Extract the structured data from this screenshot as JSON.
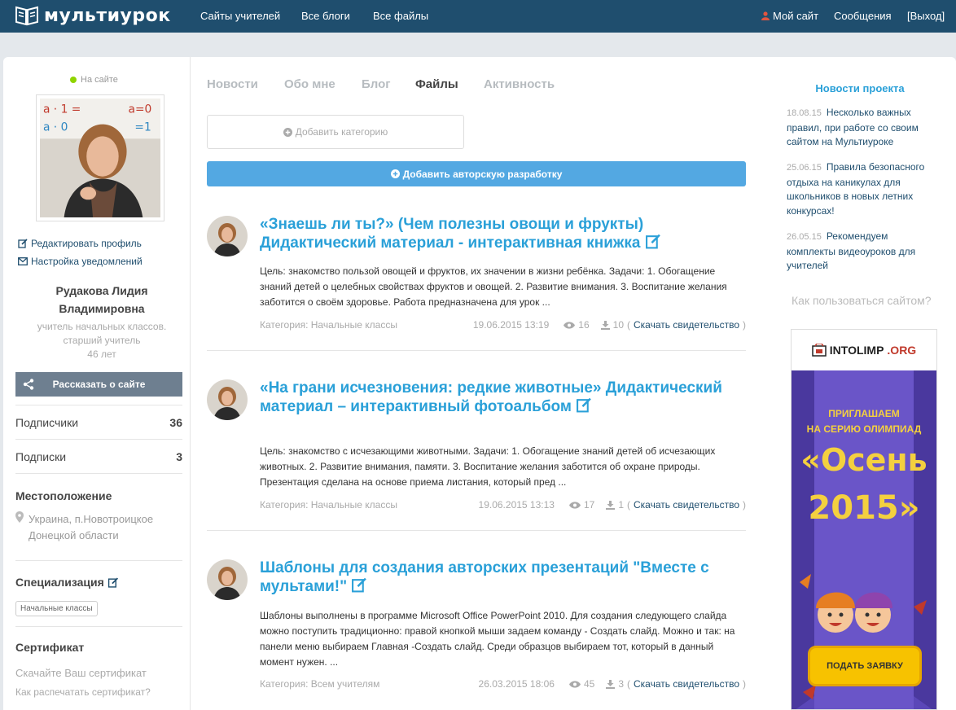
{
  "header": {
    "logo_text": "мультиурок",
    "nav": [
      "Сайты учителей",
      "Все блоги",
      "Все файлы"
    ],
    "my_site": "Мой сайт",
    "messages": "Сообщения",
    "logout": "[Выход]"
  },
  "sidebar": {
    "online": "На сайте",
    "edit_profile": "Редактировать профиль",
    "notifications": "Настройка уведомлений",
    "name_line1": "Рудакова Лидия",
    "name_line2": "Владимировна",
    "role_line1": "учитель начальных классов.",
    "role_line2": "старший учитель",
    "age": "46 лет",
    "share": "Рассказать о сайте",
    "subscribers_label": "Подписчики",
    "subscribers_count": "36",
    "subscriptions_label": "Подписки",
    "subscriptions_count": "3",
    "location_title": "Местоположение",
    "location_line1": "Украина, п.Новотроицкое",
    "location_line2": "Донецкой области",
    "specialization_title": "Специализация",
    "specialization_tag": "Начальные классы",
    "certificate_title": "Сертификат",
    "certificate_download": "Скачайте Ваш сертификат",
    "certificate_print": "Как распечатать сертификат?"
  },
  "tabs": [
    {
      "label": "Новости"
    },
    {
      "label": "Обо мне"
    },
    {
      "label": "Блог"
    },
    {
      "label": "Файлы",
      "active": true
    },
    {
      "label": "Активность"
    }
  ],
  "actions": {
    "add_category": "Добавить категорию",
    "add_development": "Добавить авторскую разработку"
  },
  "posts": [
    {
      "title": "«Знаешь ли ты?» (Чем полезны овощи и фрукты) Дидактический материал - интерактивная книжка",
      "desc": "Цель: знакомство пользой овощей и фруктов, их значении в жизни ребёнка. Задачи: 1. Обогащение знаний детей о целебных свойствах фруктов и овощей. 2. Развитие внимания. 3. Воспитание желания заботится о своём здоровье. Работа предназначена для урок ...",
      "category": "Категория: Начальные классы",
      "date": "19.06.2015 13:19",
      "views": "16",
      "downloads": "10",
      "download_link": "Скачать свидетельство"
    },
    {
      "title": "«На грани исчезновения: редкие животные» Дидактический материал – интерактивный фотоальбом",
      "desc": "Цель: знакомство с исчезающими животными. Задачи:  1. Обогащение знаний детей об исчезающих животных. 2. Развитие внимания, памяти. 3. Воспитание желания заботится об охране природы. Презентация сделана на основе приема листания, который пред ...",
      "category": "Категория: Начальные классы",
      "date": "19.06.2015 13:13",
      "views": "17",
      "downloads": "1",
      "download_link": "Скачать свидетельство"
    },
    {
      "title": "Шаблоны для создания авторских презентаций \"Вместе с мультами!\"",
      "desc": "Шаблоны выполнены в программе Microsoft Office PowerPoint 2010. Для создания следующего слайда можно поступить традиционно: правой кнопкой мыши задаем команду - Создать слайд. Можно и так: на панели меню выбираем Главная -Создать слайд. Среди образцов выбираем тот, который в данный момент нужен. ...",
      "category": "Категория: Всем учителям",
      "date": "26.03.2015 18:06",
      "views": "45",
      "downloads": "3",
      "download_link": "Скачать свидетельство"
    }
  ],
  "news": {
    "title": "Новости проекта",
    "items": [
      {
        "date": "18.08.15",
        "text": "Несколько важных правил, при работе со своим сайтом на Мультиуроке"
      },
      {
        "date": "25.06.15",
        "text": "Правила безопасного отдыха на каникулах для школьников в новых летних конкурсах!"
      },
      {
        "date": "26.05.15",
        "text": "Рекомендуем комплекты видеоуроков для учителей"
      }
    ],
    "howto": "Как пользоваться сайтом?"
  },
  "banner": {
    "brand_main": "INTOLIMP",
    "brand_suffix": ".ORG",
    "line1": "ПРИГЛАШАЕМ",
    "line2": "НА СЕРИЮ ОЛИМПИАД",
    "big1": "«Осень",
    "big2": "2015»",
    "button": "ПОДАТЬ ЗАЯВКУ"
  },
  "colors": {
    "header_bg": "#1f4e6e",
    "accent_blue": "#2aa0d8",
    "button_blue": "#53a8e2",
    "banner_purple": "#5b47b8",
    "banner_yellow": "#f4d03f"
  }
}
